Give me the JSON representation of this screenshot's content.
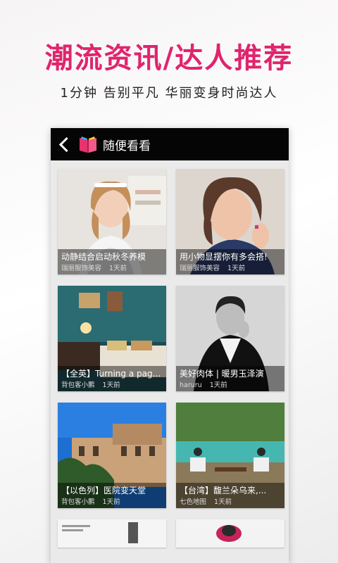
{
  "promo": {
    "headline": "潮流资讯/达人推荐",
    "tagline": "1分钟 告别平凡 华丽变身时尚达人"
  },
  "app": {
    "title": "随便看看",
    "accent": "#e0246d"
  },
  "cards": [
    {
      "title": "动静结合启动秋冬养模",
      "source": "瑞丽服饰美容",
      "time": "1天前"
    },
    {
      "title": "用小物显摆你有多会搭!",
      "source": "瑞丽服饰美容",
      "time": "1天前"
    },
    {
      "title": "【全英】Turning a pag...",
      "source": "背包客小鹏",
      "time": "1天前"
    },
    {
      "title": "美好肉体 | 暖男玉泽演",
      "source": "haruru",
      "time": "1天前"
    },
    {
      "title": "【以色列】医院变天堂",
      "source": "背包客小鹏",
      "time": "1天前"
    },
    {
      "title": "【台湾】馥兰朵乌来,...",
      "source": "七色地图",
      "time": "1天前"
    }
  ]
}
